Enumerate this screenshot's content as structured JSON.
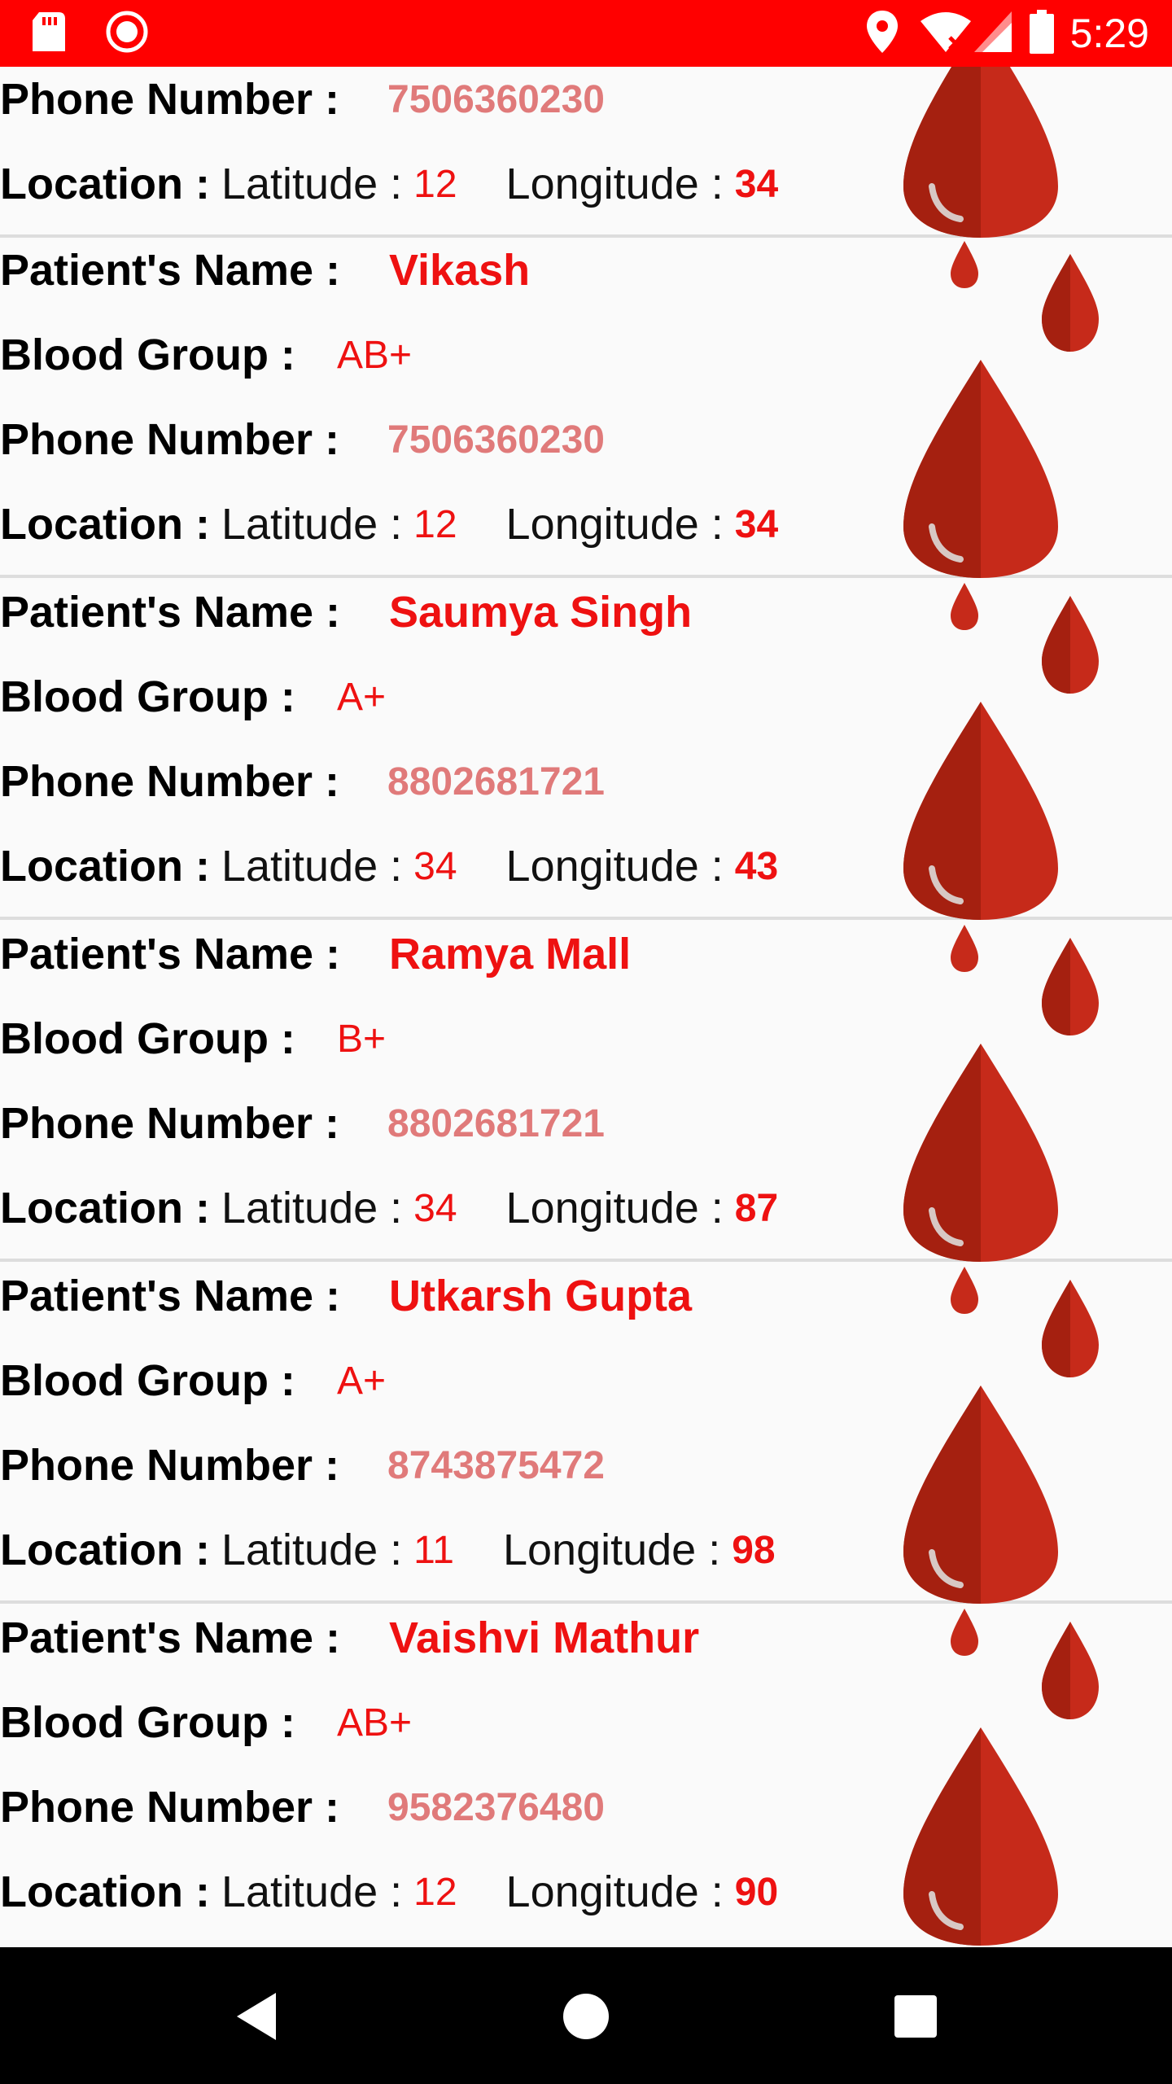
{
  "status_bar": {
    "time": "5:29",
    "icons": [
      "sd-card-icon",
      "record-icon",
      "location-icon",
      "wifi-icon",
      "signal-icon",
      "battery-icon"
    ],
    "background": "#ff0000"
  },
  "labels": {
    "patient_name": "Patient's Name :",
    "blood_group": "Blood Group :",
    "phone_number": "Phone Number :",
    "location": "Location :",
    "latitude": "Latitude :",
    "longitude": "Longitude :"
  },
  "colors": {
    "accent_red": "#ee1111",
    "phone_pink": "#e07a7a",
    "drop_red": "#c62a1a"
  },
  "partial_request": {
    "phone": "7506360230",
    "latitude": "12",
    "longitude": "34"
  },
  "requests": [
    {
      "name": "Vikash",
      "blood_group": "AB+",
      "phone": "7506360230",
      "latitude": "12",
      "longitude": "34"
    },
    {
      "name": "Saumya Singh",
      "blood_group": "A+",
      "phone": "8802681721",
      "latitude": "34",
      "longitude": "43"
    },
    {
      "name": "Ramya Mall",
      "blood_group": "B+",
      "phone": "8802681721",
      "latitude": "34",
      "longitude": "87"
    },
    {
      "name": "Utkarsh Gupta",
      "blood_group": "A+",
      "phone": "8743875472",
      "latitude": "11",
      "longitude": "98"
    },
    {
      "name": "Vaishvi Mathur",
      "blood_group": "AB+",
      "phone": "9582376480",
      "latitude": "12",
      "longitude": "90"
    }
  ],
  "nav_bar": {
    "buttons": [
      "back-icon",
      "home-icon",
      "recents-icon"
    ]
  }
}
